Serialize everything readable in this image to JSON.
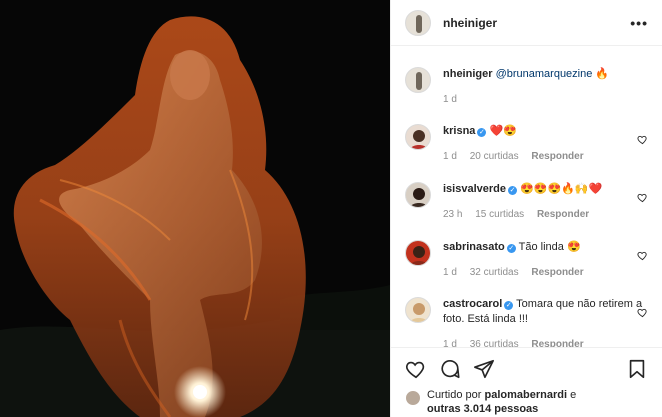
{
  "post": {
    "author": "nheiniger",
    "more_icon": "more-horizontal-icon"
  },
  "caption": {
    "user": "nheiniger",
    "mention": "@brunamarquezine",
    "emoji": "🔥",
    "time": "1 d"
  },
  "comments": [
    {
      "user": "krisna",
      "verified": true,
      "text": "",
      "emoji": "❤️😍",
      "time": "1 d",
      "likes": "20 curtidas",
      "reply": "Responder"
    },
    {
      "user": "isisvalverde",
      "verified": true,
      "text": "",
      "emoji": "😍😍😍🔥🙌❤️",
      "time": "23 h",
      "likes": "15 curtidas",
      "reply": "Responder"
    },
    {
      "user": "sabrinasato",
      "verified": true,
      "text": "Tão linda",
      "emoji": "😍",
      "time": "1 d",
      "likes": "32 curtidas",
      "reply": "Responder"
    },
    {
      "user": "castrocarol",
      "verified": true,
      "text": "Tomara que não retirem a foto. Está linda !!!",
      "emoji": "",
      "time": "1 d",
      "likes": "36 curtidas",
      "reply": "Responder"
    }
  ],
  "actions": {
    "liked_by_prefix": "Curtido por",
    "liked_by_user": "palomabernardi",
    "liked_by_mid": " e",
    "liked_by_others": "outras 3.014 pessoas"
  },
  "colors": {
    "link": "#00376b",
    "verified": "#3897f0",
    "muted": "#8e8e8e"
  }
}
